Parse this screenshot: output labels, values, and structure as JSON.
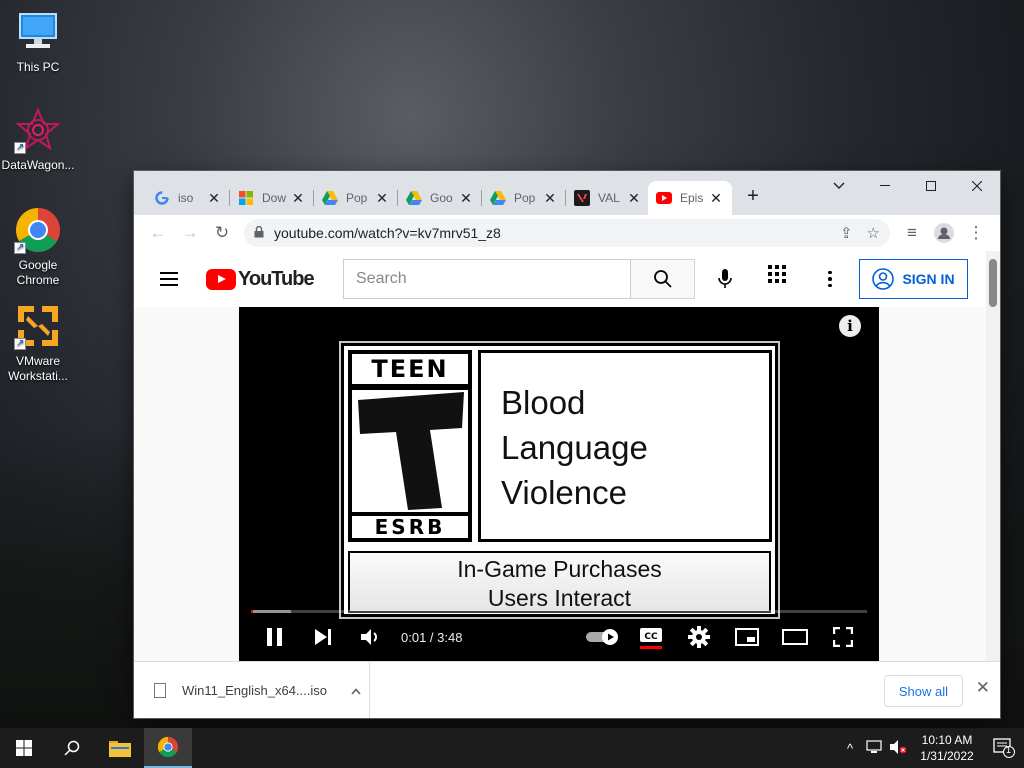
{
  "desktop": {
    "icons": [
      {
        "label": "This PC"
      },
      {
        "label": "DataWagon..."
      },
      {
        "label": "Google Chrome"
      },
      {
        "label": "VMware Workstati..."
      }
    ]
  },
  "browser": {
    "tabs": [
      {
        "title": "iso",
        "favicon": "google-icon"
      },
      {
        "title": "Dow",
        "favicon": "microsoft-icon"
      },
      {
        "title": "Pop",
        "favicon": "google-drive-icon"
      },
      {
        "title": "Goo",
        "favicon": "google-drive-icon"
      },
      {
        "title": "Pop",
        "favicon": "google-drive-icon"
      },
      {
        "title": "VAL",
        "favicon": "valorant-icon"
      },
      {
        "title": "Epis",
        "favicon": "youtube-icon",
        "active": true
      }
    ],
    "url": "youtube.com/watch?v=kv7mrv51_z8"
  },
  "youtube": {
    "logo_text": "YouTube",
    "search_placeholder": "Search",
    "sign_in": "SIGN IN"
  },
  "video": {
    "rating": {
      "age": "TEEN",
      "org": "ESRB",
      "descriptors": [
        "Blood",
        "Language",
        "Violence"
      ],
      "interactive": [
        "In-Game Purchases",
        "Users Interact"
      ]
    },
    "time": "0:01 / 3:48",
    "progress_played": 0.003,
    "progress_loaded": 0.065
  },
  "downloads": {
    "file": "Win11_English_x64....iso",
    "show_all": "Show all"
  },
  "taskbar": {
    "time": "10:10 AM",
    "date": "1/31/2022",
    "notification_count": "1"
  }
}
